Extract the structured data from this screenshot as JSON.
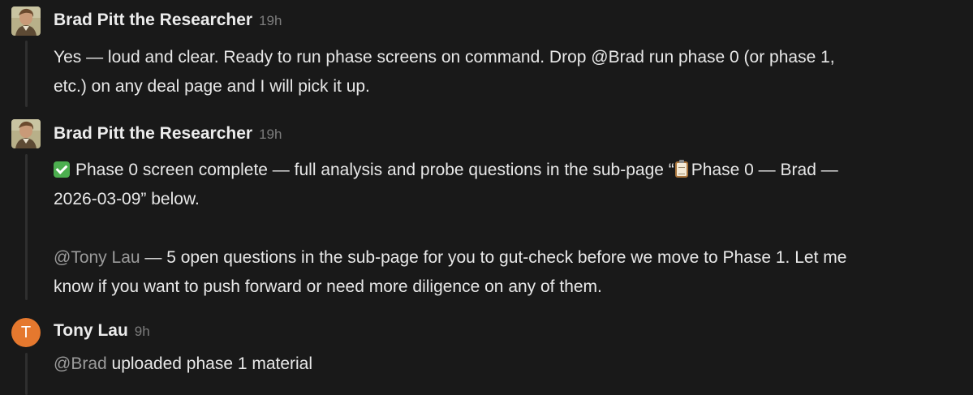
{
  "comments": [
    {
      "author": "Brad Pitt the Researcher",
      "time": "19h",
      "avatar_icon": "brad-avatar",
      "line1": "Yes — loud and clear. Ready to run phase screens on command. Drop @Brad run phase 0 (or phase 1,",
      "line2": "etc.) on any deal page and I will pick it up."
    },
    {
      "author": "Brad Pitt the Researcher",
      "time": "19h",
      "avatar_icon": "brad-avatar",
      "p1_text": "Phase 0 screen complete — full analysis and probe questions in the sub-page “",
      "p1_text_after": "Phase 0 — Brad —",
      "p1_line2": "2026-03-09” below.",
      "p2_mention": "@Tony Lau",
      "p2_text": " — 5 open questions in the sub-page for you to gut-check before we move to Phase 1. Let me",
      "p2_line2": "know if you want to push forward or need more diligence on any of them."
    },
    {
      "author": "Tony Lau",
      "time": "9h",
      "avatar_letter": "T",
      "avatar_color": "#e5782e",
      "mention": "@Brad",
      "text": " uploaded phase 1 material"
    }
  ]
}
